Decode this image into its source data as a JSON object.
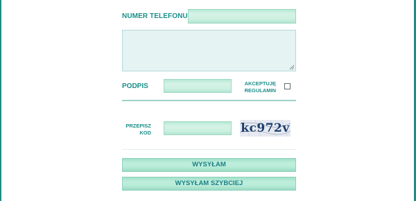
{
  "form": {
    "phone_label": "NUMER TELEFONU",
    "phone_value": "",
    "message_value": "",
    "signature_label": "PODPIS",
    "signature_value": "",
    "accept_label": "AKCEPTUJĘ REGULAMIN",
    "accept_checked": false,
    "captcha_label": "PRZEPISZ KOD",
    "captcha_value": "",
    "captcha_image_text": "kc972v",
    "send_button": "WYSYŁAM",
    "send_fast_button": "WYSYŁAM SZYBCIEJ"
  },
  "colors": {
    "accent": "#1b8f8a",
    "field_fill": "#cdf0e1",
    "textarea_fill": "#e6f3f3",
    "edge": "#1f8a86"
  },
  "icons": {
    "textarea_resize": "resize-grip-icon",
    "checkbox": "checkbox-icon"
  }
}
